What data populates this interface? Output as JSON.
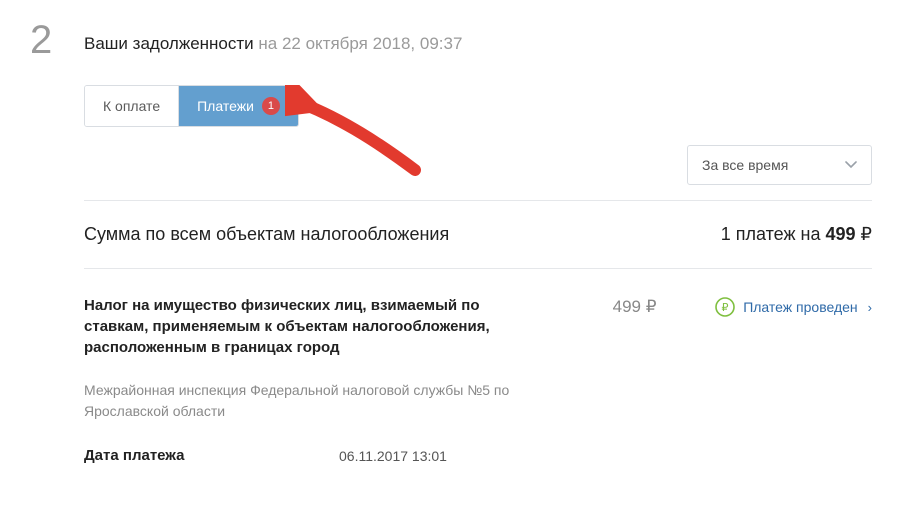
{
  "step_number": "2",
  "heading": {
    "title": "Ваши задолженности",
    "date": "на 22 октября 2018, 09:37"
  },
  "tabs": {
    "to_pay": "К оплате",
    "payments": "Платежи",
    "payments_badge": "1"
  },
  "time_filter": {
    "selected": "За все время"
  },
  "summary": {
    "label": "Сумма по всем объектам налогообложения",
    "right_prefix": "1 платеж на ",
    "right_amount": "499",
    "right_currency": "₽"
  },
  "item": {
    "title": "Налог на имущество физических лиц, взимаемый по ставкам, применяемым к объектам налогообложения, расположенным в границах город",
    "amount_value": "499",
    "amount_currency": "₽",
    "status_label": "Платеж проведен",
    "subtitle": "Межрайонная инспекция Федеральной налоговой службы №5 по Ярославской области"
  },
  "payment_date": {
    "label": "Дата платежа",
    "value": "06.11.2017 13:01"
  }
}
